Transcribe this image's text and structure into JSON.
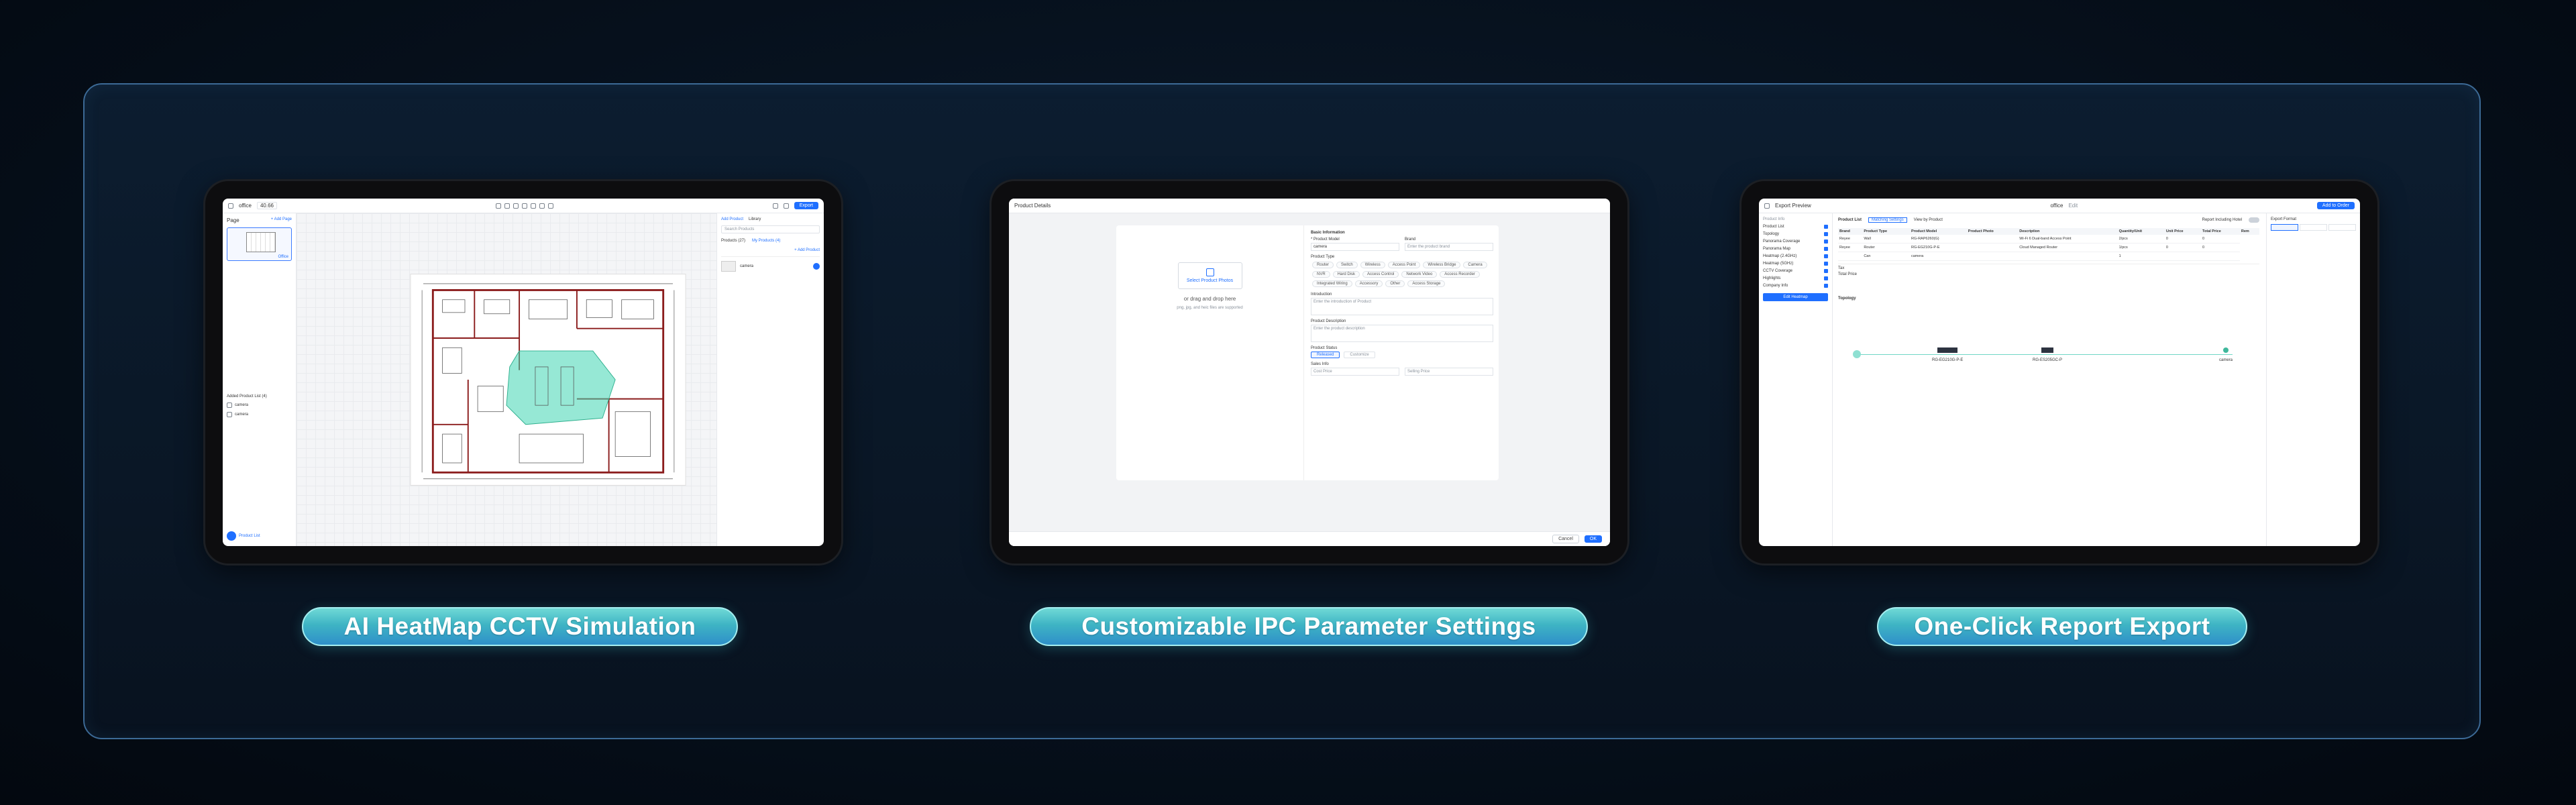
{
  "captions": {
    "left": "AI HeatMap CCTV Simulation",
    "middle": "Customizable IPC Parameter Settings",
    "right": "One-Click Report Export"
  },
  "heatmap_app": {
    "project": "office",
    "zoom": "40.66",
    "export_label": "Export",
    "page_label": "Page",
    "add_page": "+ Add Page",
    "page_thumb_label": "Office",
    "add_product_tab": "Add Product",
    "library_tab": "Library",
    "products_tab": "Products (27)",
    "my_products_tab": "My Products (4)",
    "add_product_link": "+ Add Product",
    "search_placeholder": "Search Products",
    "list_label": "Added Product List (4)",
    "product_item": "camera",
    "footer_label": "Product List"
  },
  "product_details": {
    "title": "Product Details",
    "upload_link": "Select Product Photos",
    "upload_hint": "or drag and drop here",
    "upload_formats": "png, jpg, and heic files are supported",
    "basic_info": "Basic Information",
    "product_model_label": "* Product Model",
    "product_model_value": "camera",
    "brand_label": "Brand",
    "brand_placeholder": "Enter the product brand",
    "product_type_label": "Product Type",
    "types": [
      "Router",
      "Switch",
      "Wireless",
      "Access Point",
      "Wireless Bridge",
      "Camera",
      "NVR",
      "Hard Disk",
      "Access Control",
      "Network Video",
      "Access Recorder",
      "Integrated Wiring",
      "Accessory",
      "Other",
      "Access Storage"
    ],
    "introduction_label": "Introduction",
    "introduction_placeholder": "Enter the introduction of Product",
    "description_label": "Product Description",
    "description_placeholder": "Enter the product description",
    "status_label": "Product Status",
    "status_options": [
      "Released",
      "Customize"
    ],
    "sales_info": "Sales Info",
    "cost_price_label": "Cost Price",
    "selling_price_label": "Selling Price",
    "cancel_label": "Cancel",
    "ok_label": "OK"
  },
  "report_app": {
    "title": "Export Preview",
    "project": "office",
    "edit_label": "Edit",
    "download_label": "Add to Order",
    "nav_title": "Product Info",
    "nav_items": [
      "Product List",
      "Topology",
      "Panorama Coverage",
      "Panorama Map",
      "Heatmap (2.4GHz)",
      "Heatmap (5GHz)",
      "CCTV Coverage",
      "Highlights",
      "Company Info"
    ],
    "nav_button": "Edit Heatmap",
    "product_list_label": "Product List",
    "tab_matching": "Matching Settings",
    "tab_view": "View by Product",
    "report_toggle": "Report Including Hotel",
    "export_settings": "Export Format",
    "columns": [
      "Brand",
      "Product Type",
      "Product Model",
      "Product Photo",
      "Description",
      "Quantity/Unit",
      "Unit Price",
      "Total Price",
      "Rem"
    ],
    "rows": [
      [
        "Reyee",
        "Wall",
        "RG-RAP6260(G)",
        "",
        "Wi-Fi 6 Dual-band Access Point",
        "2/pcs",
        "0",
        "0"
      ],
      [
        "Reyee",
        "Router",
        "RG-EG210G-P-E",
        "",
        "Cloud Managed Router",
        "1/pcs",
        "0",
        "0"
      ],
      [
        "",
        "Can",
        "camera",
        "",
        "",
        "1",
        "",
        ""
      ]
    ],
    "tax_label": "Tax",
    "total_label": "Total Price",
    "topology_label": "Topology",
    "topology_nodes": [
      "RG-EG210G-P-E",
      "RG-ES205GC-P",
      "camera"
    ]
  }
}
